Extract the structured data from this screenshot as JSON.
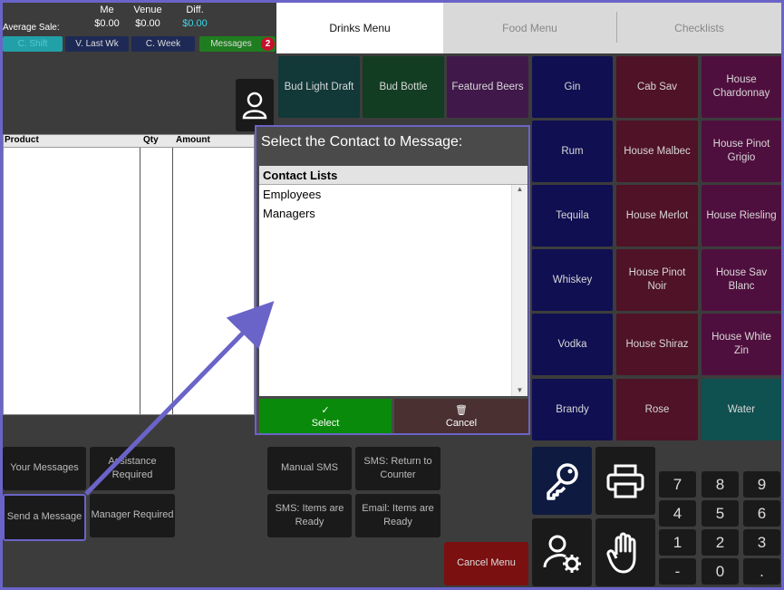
{
  "stats": {
    "avg_label": "Average Sale:",
    "me_header": "Me",
    "venue_header": "Venue",
    "diff_header": "Diff.",
    "me_value": "$0.00",
    "venue_value": "$0.00",
    "diff_value": "$0.00",
    "diff_color": "#38d8e8"
  },
  "periods": {
    "shift": "C. Shift",
    "last_week": "V. Last Wk",
    "week": "C. Week",
    "messages": "Messages",
    "messages_count": "2"
  },
  "order": {
    "col_product": "Product",
    "col_qty": "Qty",
    "col_amount": "Amount"
  },
  "tabs": [
    "Drinks Menu",
    "Food Menu",
    "Checklists"
  ],
  "products": [
    {
      "label": "Bud Light Draft",
      "color": "#123838"
    },
    {
      "label": "Bud Bottle",
      "color": "#123d22"
    },
    {
      "label": "Featured Beers",
      "color": "#40184a"
    },
    {
      "label": "Gin",
      "color": "#0f0f52"
    },
    {
      "label": "Cab Sav",
      "color": "#4f1226"
    },
    {
      "label": "House Chardonnay",
      "color": "#4f0f3e"
    },
    {
      "label": "Rum",
      "color": "#0f0f52"
    },
    {
      "label": "House Malbec",
      "color": "#4f1226"
    },
    {
      "label": "House Pinot Grigio",
      "color": "#4f0f3e"
    },
    {
      "label": "Tequila",
      "color": "#0f0f52"
    },
    {
      "label": "House Merlot",
      "color": "#4f1226"
    },
    {
      "label": "House Riesling",
      "color": "#4f0f3e"
    },
    {
      "label": "Whiskey",
      "color": "#0f0f52"
    },
    {
      "label": "House Pinot Noir",
      "color": "#4f1226"
    },
    {
      "label": "House Sav Blanc",
      "color": "#4f0f3e"
    },
    {
      "label": "Vodka",
      "color": "#0f0f52"
    },
    {
      "label": "House Shiraz",
      "color": "#4f1226"
    },
    {
      "label": "House White Zin",
      "color": "#4f0f3e"
    },
    {
      "label": "Brandy",
      "color": "#0f0f52"
    },
    {
      "label": "Rose",
      "color": "#4f1226"
    },
    {
      "label": "Water",
      "color": "#0f5050"
    }
  ],
  "dialog": {
    "title": "Select the Contact to Message:",
    "list_header": "Contact Lists",
    "items": [
      "Employees",
      "Managers"
    ],
    "select_label": "Select",
    "cancel_label": "Cancel",
    "select_color": "#0a8a0a",
    "cancel_color": "#4a3030"
  },
  "actions": {
    "your_messages": "Your Messages",
    "assistance": "Assistance Required",
    "send_message": "Send a Message",
    "manager": "Manager Required",
    "manual_sms": "Manual SMS",
    "sms_return": "SMS: Return to Counter",
    "sms_ready": "SMS: Items are Ready",
    "email_ready": "Email: Items are Ready",
    "cancel_menu": "Cancel Menu"
  },
  "keypad": [
    "7",
    "8",
    "9",
    "4",
    "5",
    "6",
    "1",
    "2",
    "3",
    "-",
    "0",
    "."
  ],
  "icons": [
    "user-icon",
    "key-icon",
    "printer-icon",
    "user-settings-icon",
    "hand-icon",
    "check-icon",
    "trash-icon"
  ]
}
